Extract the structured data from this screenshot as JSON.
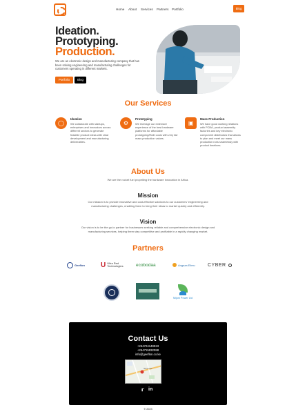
{
  "nav": {
    "items": [
      "Home",
      "About",
      "Services",
      "Partners",
      "Portfolio"
    ],
    "blog_label": "Blog"
  },
  "hero": {
    "line1": "Ideation.",
    "line2": "Prototyping.",
    "line3": "Production.",
    "description": "We are an electronic design and manufacturing company that has been solving engineering and manufacturing challenges for customers operating in different markets.",
    "primary_btn": "Portfolio",
    "secondary_btn": "Blog"
  },
  "services": {
    "title": "Our Services",
    "items": [
      {
        "icon": "lightbulb-icon",
        "title": "Ideation",
        "text": "We collaborate with startups, enterprises and innovators across different sectors to generate feasible product ideas with clear development and manufacturing deliverables."
      },
      {
        "icon": "gear-icon",
        "title": "Prototyping",
        "text": "We leverage our extensive experience of the best hardware platforms for affordable prototyping/R&D costs with very fair mass production values."
      },
      {
        "icon": "factory-icon",
        "title": "Mass Production",
        "text": "We have good working relations with PCBA, product assembly factories and key electronic component distributors that allows to plan and meet our mass production runs seamlessly with product timelines."
      }
    ]
  },
  "about": {
    "title": "About Us",
    "tagline": "We are the rocket fuel propelling the hardware innovation in Africa.",
    "mission_title": "Mission",
    "mission_text": "Our mission is to provide innovative and cost-effective solutions to our customers' engineering and manufacturing challenges, enabling them to bring their ideas to market quickly and efficiently.",
    "vision_title": "Vision",
    "vision_text": "Our vision is to be the go-to partner for businesses seeking reliable and comprehensive electronic design and manufacturing services, helping them stay competitive and profitable in a rapidly changing market."
  },
  "partners": {
    "title": "Partners",
    "row1": [
      "Geeflon",
      "Ultra Red Technologies",
      "ecobodaa",
      "Angaza Elimu",
      "CYBER"
    ],
    "row2": [
      "",
      "",
      "Mijoni Power Ltd"
    ]
  },
  "contact": {
    "title": "Contact Us",
    "phone1": "+254724149923",
    "phone2": "+254715932088",
    "email": "info@geeflon.co.ke",
    "map_label": "Stima Lane"
  },
  "footer": {
    "copyright": "© 2023"
  },
  "colors": {
    "accent": "#ef6c12",
    "dark": "#000000"
  }
}
